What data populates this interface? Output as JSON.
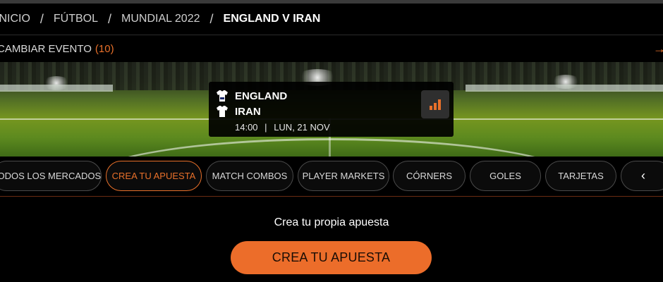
{
  "breadcrumb": {
    "items": [
      "INICIO",
      "FÚTBOL",
      "MUNDIAL 2022"
    ],
    "current": "ENGLAND V IRAN",
    "separator": "/"
  },
  "event_bar": {
    "label": "CAMBIAR EVENTO",
    "count": "(10)",
    "arrow_icon": "arrow-right-icon"
  },
  "match": {
    "home_team": "ENGLAND",
    "away_team": "IRAN",
    "time": "14:00",
    "separator": "|",
    "date": "LUN, 21 NOV",
    "stats_icon": "bar-chart-icon"
  },
  "tabs": [
    {
      "label": "TODOS LOS MERCADOS",
      "active": false
    },
    {
      "label": "CREA TU APUESTA",
      "active": true
    },
    {
      "label": "MATCH COMBOS",
      "active": false
    },
    {
      "label": "PLAYER MARKETS",
      "active": false
    },
    {
      "label": "CÓRNERS",
      "active": false
    },
    {
      "label": "GOLES",
      "active": false
    },
    {
      "label": "TARJETAS",
      "active": false
    }
  ],
  "tabs_scroll_icon": "chevron-left-icon",
  "builder": {
    "prompt": "Crea tu propia apuesta",
    "button_label": "CREA TU APUESTA"
  },
  "colors": {
    "accent": "#e8702a",
    "background": "#000000",
    "cta": "#ec6d2a"
  }
}
